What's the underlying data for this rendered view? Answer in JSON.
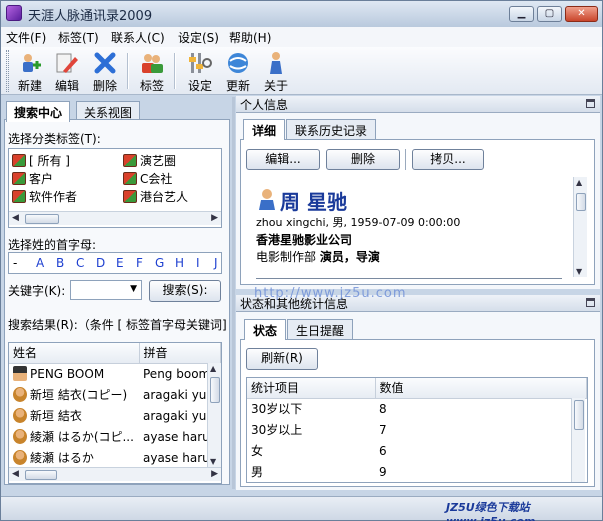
{
  "window": {
    "title": "天涯人脉通讯录2009"
  },
  "menu": [
    "文件(F)",
    "标签(T)",
    "联系人(C)",
    "设定(S)",
    "帮助(H)"
  ],
  "toolbar": {
    "new": "新建",
    "edit": "编辑",
    "delete": "删除",
    "tag": "标签",
    "settings": "设定",
    "update": "更新",
    "about": "关于"
  },
  "left_tabs": [
    "搜索中心",
    "关系视图"
  ],
  "tag_section": {
    "label": "选择分类标签(T):",
    "tags": [
      "[ 所有 ]",
      "演艺圈",
      "客户",
      "C会社",
      "软件作者",
      "港台艺人"
    ]
  },
  "initial_section": {
    "label": "选择姓的首字母:",
    "letters": [
      "-",
      "A",
      "B",
      "C",
      "D",
      "E",
      "F",
      "G",
      "H",
      "I",
      "J"
    ]
  },
  "keyword": {
    "label": "关键字(K):",
    "search_button": "搜索(S):"
  },
  "results": {
    "label": "搜索结果(R):（条件 [ 标签首字母关键词]",
    "columns": [
      "姓名",
      "拼音"
    ],
    "rows": [
      {
        "name": "PENG BOOM",
        "pinyin": "Peng boom"
      },
      {
        "name": "新垣 結衣(コピー)",
        "pinyin": "aragaki yu"
      },
      {
        "name": "新垣 結衣",
        "pinyin": "aragaki yu"
      },
      {
        "name": "綾瀬 はるか(コピ...",
        "pinyin": "ayase haru"
      },
      {
        "name": "綾瀬 はるか",
        "pinyin": "ayase haru"
      }
    ]
  },
  "personal_panel": {
    "title": "个人信息",
    "tabs": [
      "详细",
      "联系历史记录"
    ],
    "buttons": [
      "编辑...",
      "删除",
      "拷贝..."
    ],
    "contact": {
      "name": "周 星驰",
      "line1": "zhou xingchi, 男, 1959-07-09 0:00:00",
      "company": "香港星驰影业公司",
      "dept_prefix": "电影制作部 ",
      "role": "演员，导演"
    }
  },
  "stats_panel": {
    "title": "状态和其他统计信息",
    "tabs": [
      "状态",
      "生日提醒"
    ],
    "refresh": "刷新(R)",
    "columns": [
      "统计项目",
      "数值"
    ],
    "rows": [
      {
        "item": "30岁以下",
        "value": "8"
      },
      {
        "item": "30岁以上",
        "value": "7"
      },
      {
        "item": "女",
        "value": "6"
      },
      {
        "item": "男",
        "value": "9"
      }
    ]
  },
  "overlay_watermark": "http://www.jz5u.com",
  "status_watermark": "JZ5U绿色下载站www.jz5u.com"
}
